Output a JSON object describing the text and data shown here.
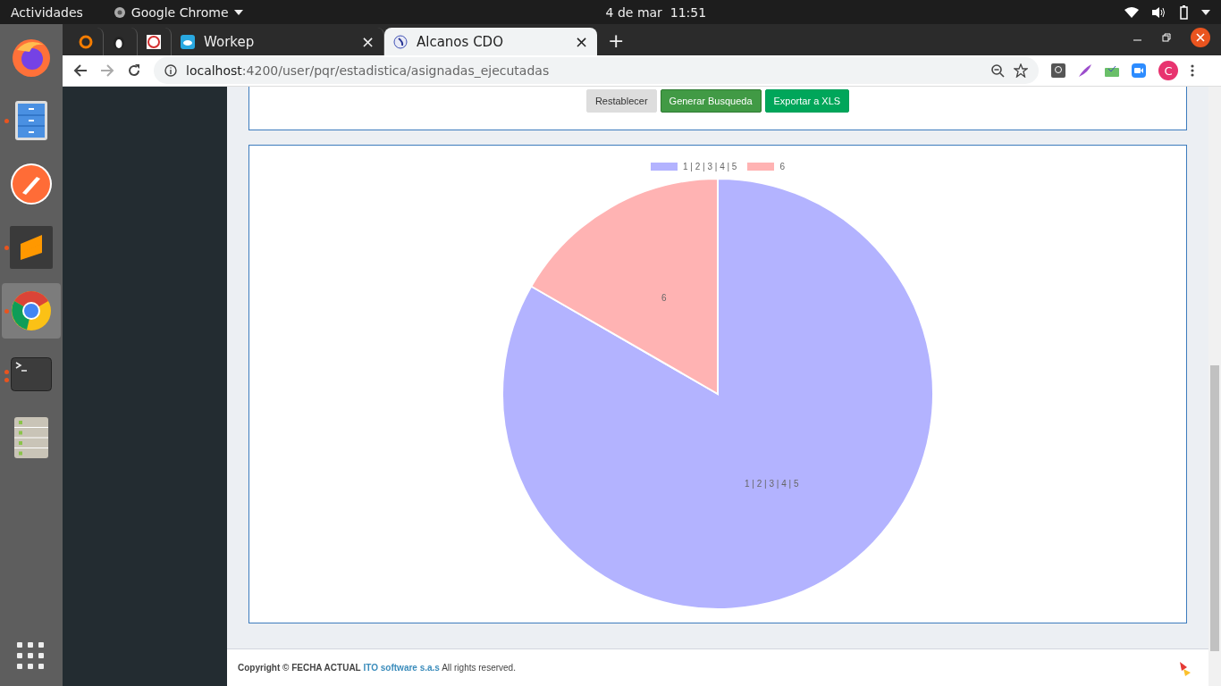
{
  "top_bar": {
    "activities": "Actividades",
    "app_menu": "Google Chrome",
    "clock": "4 de mar  11:51"
  },
  "dock": [
    {
      "running": false,
      "two_windows": false,
      "selected": false
    },
    {
      "running": true,
      "two_windows": false,
      "selected": false
    },
    {
      "running": false,
      "two_windows": false,
      "selected": false
    },
    {
      "running": true,
      "two_windows": false,
      "selected": false
    },
    {
      "running": true,
      "two_windows": false,
      "selected": true
    },
    {
      "running": true,
      "two_windows": true,
      "selected": false
    },
    {
      "running": false,
      "two_windows": false,
      "selected": false
    }
  ],
  "tabs": [
    {
      "kind": "pinned",
      "selected": false
    },
    {
      "kind": "pinned",
      "selected": false
    },
    {
      "kind": "pinned",
      "selected": false
    },
    {
      "kind": "normal",
      "title": "Workep",
      "close": "×",
      "selected": false
    },
    {
      "kind": "normal",
      "title": "Alcanos CDO",
      "close": "×",
      "selected": true
    }
  ],
  "new_tab": "+",
  "address": {
    "host": "localhost",
    "rest": ":4200/user/pqr/estadistica/asignadas_ejecutadas"
  },
  "profile": "C",
  "buttons": [
    {
      "kind": "neutral",
      "label": "Restablecer"
    },
    {
      "kind": "primary",
      "label": "Generar Busqueda"
    },
    {
      "kind": "export",
      "label": "Exportar a XLS"
    }
  ],
  "chart": {
    "chart_data": {
      "type": "pie",
      "categories": [
        "1 | 2 | 3 | 4 | 5",
        "6"
      ],
      "values": [
        5,
        1
      ],
      "colors": [
        "#b3b3ff",
        "#ffb3b3"
      ]
    }
  },
  "footer": {
    "text": "**Copyright © FECHA ACTUAL** ",
    "link": "ITO software s.a.s",
    "rest": " All rights reserved."
  }
}
